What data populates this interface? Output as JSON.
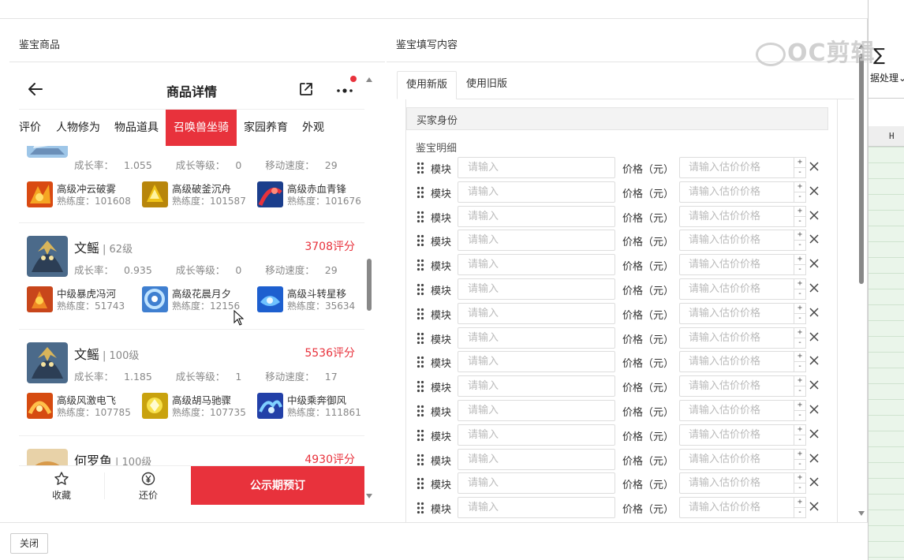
{
  "background_app": {
    "sigma": "∑",
    "ribbon_text": "据处理",
    "column": "H"
  },
  "watermark": "OC剪辑",
  "left_section": {
    "title": "鉴宝商品"
  },
  "right_section": {
    "title": "鉴宝填写内容"
  },
  "phone": {
    "title": "商品详情",
    "tabs": [
      {
        "label": "评价",
        "active": false
      },
      {
        "label": "人物修为",
        "active": false
      },
      {
        "label": "物品道具",
        "active": false
      },
      {
        "label": "召唤兽坐骑",
        "active": true
      },
      {
        "label": "家园养育",
        "active": false
      },
      {
        "label": "外观",
        "active": false
      }
    ],
    "stat_labels": {
      "growth": "成长率：",
      "growth_level": "成长等级：",
      "speed": "移动速度："
    },
    "prof_label": "熟练度：",
    "pets": [
      {
        "name": "",
        "level": "",
        "score": "",
        "growth": "1.055",
        "growth_level": "0",
        "speed": "29",
        "skills": [
          {
            "name": "高级冲云破雾",
            "prof": "101608"
          },
          {
            "name": "高级破釜沉舟",
            "prof": "101587"
          },
          {
            "name": "高级赤血青锋",
            "prof": "101676"
          }
        ]
      },
      {
        "name": "文鳐",
        "level": "62级",
        "score": "3708评分",
        "growth": "0.935",
        "growth_level": "0",
        "speed": "29",
        "skills": [
          {
            "name": "中级暴虎冯河",
            "prof": "51743"
          },
          {
            "name": "高级花晨月夕",
            "prof": "12156"
          },
          {
            "name": "高级斗转星移",
            "prof": "35634"
          }
        ]
      },
      {
        "name": "文鳐",
        "level": "100级",
        "score": "5536评分",
        "growth": "1.185",
        "growth_level": "1",
        "speed": "17",
        "skills": [
          {
            "name": "高级风激电飞",
            "prof": "107785"
          },
          {
            "name": "高级胡马驰骤",
            "prof": "107735"
          },
          {
            "name": "中级乘奔御风",
            "prof": "111861"
          }
        ]
      },
      {
        "name": "何罗鱼",
        "level": "100级",
        "score": "4930评分"
      }
    ],
    "bottom": {
      "favorite": "收藏",
      "bargain": "还价",
      "reserve": "公示期预订"
    }
  },
  "form": {
    "tabs": [
      {
        "label": "使用新版",
        "active": true
      },
      {
        "label": "使用旧版",
        "active": false
      }
    ],
    "buyer_identity": "买家身份",
    "detail_label": "鉴宝明细",
    "row_label": "模块",
    "row_placeholder": "请输入",
    "price_label": "价格（元）",
    "price_placeholder": "请输入估价价格",
    "stepper_up": "+",
    "stepper_down": "-",
    "row_count": 15
  },
  "footer": {
    "close": "关闭"
  },
  "colors": {
    "accent_red": "#e8323c",
    "border": "#e4e4e4"
  }
}
